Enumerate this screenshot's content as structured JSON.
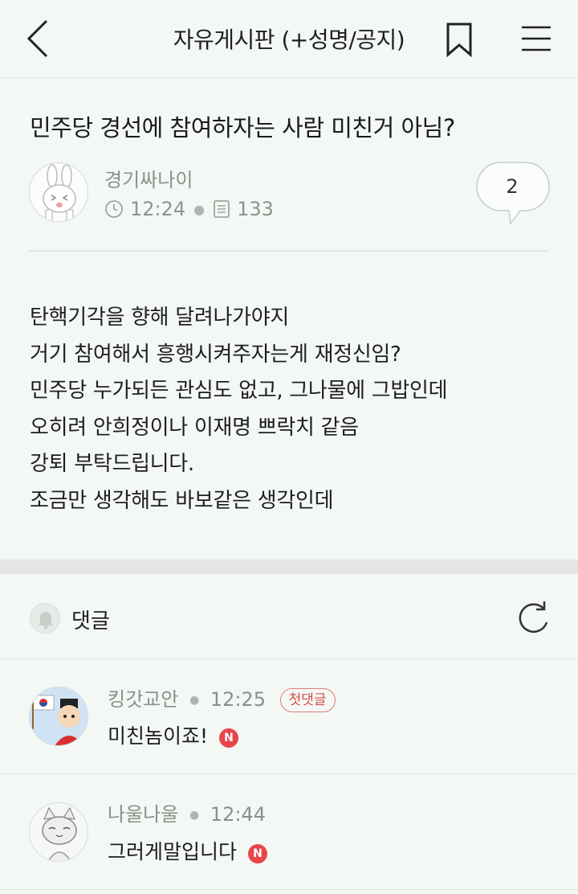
{
  "header": {
    "board_title": "자유게시판 (+성명/공지)"
  },
  "post": {
    "title": "민주당 경선에 참여하자는 사람 미친거 아님?",
    "author": "경기싸나이",
    "time": "12:24",
    "views": "133",
    "comment_count": "2",
    "body_lines": [
      "탄핵기각을 향해 달려나가야지",
      "거기 참여해서 흥행시켜주자는게 재정신임?",
      "민주당 누가되든 관심도 없고, 그나물에 그밥인데",
      "오히려 안희정이나 이재명 쁘락치 같음",
      "강퇴 부탁드립니다.",
      "조금만 생각해도 바보같은 생각인데"
    ]
  },
  "comments_section": {
    "label": "댓글"
  },
  "comments": [
    {
      "author": "킹갓교안",
      "time": "12:25",
      "badge": "첫댓글",
      "text": "미친놈이죠!",
      "new_mark": "N"
    },
    {
      "author": "나울나울",
      "time": "12:44",
      "text": "그러게말입니다",
      "new_mark": "N"
    }
  ],
  "colors": {
    "background": "#f4f8f4",
    "accent_red": "#e8454a",
    "muted_text": "#8a8f8a"
  }
}
